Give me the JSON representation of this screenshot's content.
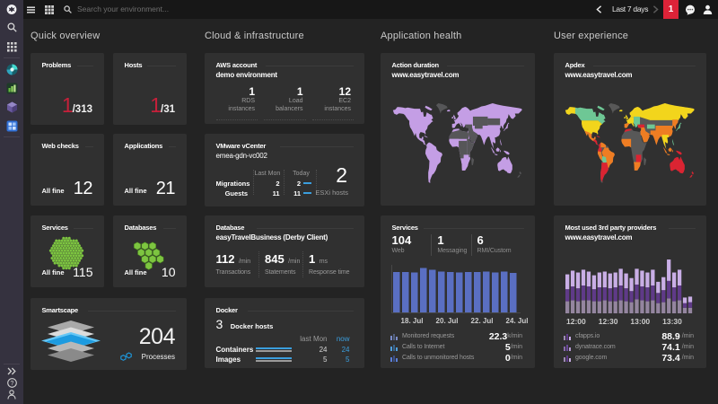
{
  "topbar": {
    "search_placeholder": "Search your environment...",
    "time_range": "Last 7 days",
    "problem_count": "1"
  },
  "quick_overview": {
    "header": "Quick overview",
    "problems": {
      "title": "Problems",
      "value": "1",
      "total": "/313"
    },
    "hosts": {
      "title": "Hosts",
      "value": "1",
      "total": "/31"
    },
    "web_checks": {
      "title": "Web checks",
      "status": "All fine",
      "value": "12"
    },
    "applications": {
      "title": "Applications",
      "status": "All fine",
      "value": "21"
    },
    "services": {
      "title": "Services",
      "status": "All fine",
      "value": "115",
      "hex_count": 115,
      "hex_color": "#7dc540"
    },
    "databases": {
      "title": "Databases",
      "status": "All fine",
      "value": "10",
      "hex_count": 10,
      "hex_color": "#7dc540"
    },
    "smartscape": {
      "title": "Smartscape",
      "value": "204",
      "label": "Processes"
    }
  },
  "cloud": {
    "header": "Cloud & infrastructure",
    "aws": {
      "title": "AWS account",
      "subtitle": "demo environment",
      "stats": [
        {
          "value": "1",
          "label1": "RDS",
          "label2": "instances"
        },
        {
          "value": "1",
          "label1": "Load",
          "label2": "balancers"
        },
        {
          "value": "12",
          "label1": "EC2",
          "label2": "instances"
        }
      ]
    },
    "vmware": {
      "title": "VMware vCenter",
      "subtitle": "emea-gdn-vc002",
      "col_last": "Last Mon",
      "col_today": "Today",
      "rows": [
        {
          "label": "Migrations",
          "last": "2",
          "today": "2"
        },
        {
          "label": "Guests",
          "last": "11",
          "today": "11"
        }
      ],
      "big_value": "2",
      "big_label": "ESXi hosts"
    },
    "database": {
      "title": "Database",
      "subtitle": "easyTravelBusiness (Derby Client)",
      "stats": [
        {
          "value": "112",
          "unit": "/min",
          "label": "Transactions"
        },
        {
          "value": "845",
          "unit": "/min",
          "label": "Statements"
        },
        {
          "value": "1",
          "unit": "ms",
          "label": "Response time"
        }
      ]
    },
    "docker": {
      "title": "Docker",
      "hosts_value": "3",
      "hosts_label": "Docker hosts",
      "col_last": "last Mon",
      "col_now": "now",
      "rows": [
        {
          "label": "Containers",
          "last": "24",
          "now": "24"
        },
        {
          "label": "Images",
          "last": "5",
          "now": "5"
        }
      ]
    }
  },
  "app_health": {
    "header": "Application health",
    "action_duration": {
      "title": "Action duration",
      "subtitle": "www.easytravel.com"
    },
    "services": {
      "title": "Services",
      "stats": [
        {
          "value": "104",
          "label": "Web"
        },
        {
          "value": "1",
          "label": "Messaging"
        },
        {
          "value": "6",
          "label": "RMI/Custom"
        }
      ],
      "metrics": [
        {
          "name": "Monitored requests",
          "value": "22.3",
          "unit": "k/min"
        },
        {
          "name": "Calls to Internet",
          "value": "5",
          "unit": "/min"
        },
        {
          "name": "Calls to unmonitored hosts",
          "value": "0",
          "unit": "/min"
        }
      ]
    }
  },
  "user_experience": {
    "header": "User experience",
    "apdex": {
      "title": "Apdex",
      "subtitle": "www.easytravel.com"
    },
    "providers": {
      "title": "Most used 3rd party providers",
      "subtitle": "www.easytravel.com",
      "metrics": [
        {
          "name": "cfapps.io",
          "value": "88.9",
          "unit": "/min"
        },
        {
          "name": "dynatrace.com",
          "value": "74.1",
          "unit": "/min"
        },
        {
          "name": "google.com",
          "value": "73.4",
          "unit": "/min"
        }
      ]
    }
  },
  "chart_data": [
    {
      "id": "services-requests",
      "type": "bar",
      "title": "Monitored requests per minute",
      "color": "#5a6fc2",
      "x_tick_labels": [
        "18. Jul",
        "20. Jul",
        "22. Jul",
        "24. Jul"
      ],
      "x_tick_bar_index": [
        2.1,
        6.0,
        9.9,
        13.8
      ],
      "values": [
        45,
        45,
        44.5,
        49.5,
        47.5,
        45.5,
        45,
        44.5,
        45,
        45,
        45.5,
        44.5,
        45.5,
        44
      ],
      "ymax": 55
    },
    {
      "id": "third-party-stacked",
      "type": "stacked-bar",
      "title": "3rd party provider calls per minute",
      "colors_bottom_to_top": [
        "#94859f",
        "#5f3a88",
        "#c9aee6"
      ],
      "x_tick_labels": [
        "12:00",
        "12:30",
        "13:00",
        "13:30"
      ],
      "x_tick_bar_index": [
        2,
        8,
        14,
        20
      ],
      "stacks": [
        [
          13,
          13,
          16
        ],
        [
          14,
          15,
          17
        ],
        [
          13,
          14,
          17
        ],
        [
          14,
          16,
          17
        ],
        [
          14,
          15,
          16
        ],
        [
          13,
          13,
          15
        ],
        [
          13,
          15,
          16
        ],
        [
          14,
          14,
          17
        ],
        [
          13,
          14,
          16
        ],
        [
          13,
          15,
          16
        ],
        [
          14,
          16,
          18
        ],
        [
          13,
          14,
          16
        ],
        [
          12,
          12,
          14
        ],
        [
          15,
          16,
          17
        ],
        [
          14,
          15,
          17
        ],
        [
          13,
          15,
          16
        ],
        [
          14,
          16,
          17
        ],
        [
          11,
          11,
          12
        ],
        [
          12,
          13,
          14
        ],
        [
          16,
          19,
          23
        ],
        [
          13,
          15,
          16
        ],
        [
          14,
          16,
          17
        ],
        [
          6,
          5,
          6
        ],
        [
          6,
          6,
          6
        ]
      ],
      "ymax": 60
    },
    {
      "id": "action-duration-map",
      "type": "choropleth",
      "title": "Action duration by region",
      "default_color": "#c49ee5",
      "region_colors": {
        "greenland": "#565658",
        "kazakh": "#565658",
        "centralasia": "#565658",
        "mongolia": "#565658",
        "middleeast": "#565658",
        "turkey": "#565658",
        "northafrica": "#565658",
        "centralafrica": "#565658",
        "eastafrica": "#565658",
        "madagascar": "#565658",
        "newzealand": "#565658",
        "morocco": "#c49ee5",
        "westafrica": "#c49ee5",
        "zambia": "#c49ee5",
        "southafrica": "#c49ee5"
      }
    },
    {
      "id": "apdex-map",
      "type": "choropleth",
      "title": "Apdex by region",
      "default_color": "#585858",
      "region_colors": {
        "alaska": "#f2d51c",
        "canada": "#6ec795",
        "usa": "#f2d51c",
        "mexico": "#ee7d23",
        "centralamerica": "#da2432",
        "colombia": "#da2432",
        "venezuela": "#ee7d23",
        "peru": "#ee7d23",
        "bolivia": "#6ec795",
        "brazil": "#ee7d23",
        "argentina": "#da2432",
        "iceland": "#f2d51c",
        "uk": "#f2d51c",
        "scandinavia": "#f2d51c",
        "westeu": "#f2d51c",
        "easteu": "#6ec795",
        "iberia": "#ee7d23",
        "turkey": "#da2432",
        "morocco": "#da2432",
        "russia": "#f2d51c",
        "centralasia": "#6ec795",
        "china": "#ee7d23",
        "india": "#ee7d23",
        "pakistan": "#ee7d23",
        "middleeast": "#ee7d23",
        "seasia": "#f2d51c",
        "indonesia": "#ee7d23",
        "papua": "#da2432",
        "japan": "#6ec795",
        "philippines": "#6ec795",
        "westafrica": "#ee7d23",
        "zambia": "#da2432",
        "southafrica": "#ee7d23",
        "australia": "#da2432",
        "newzealand": "#da2432"
      }
    }
  ]
}
